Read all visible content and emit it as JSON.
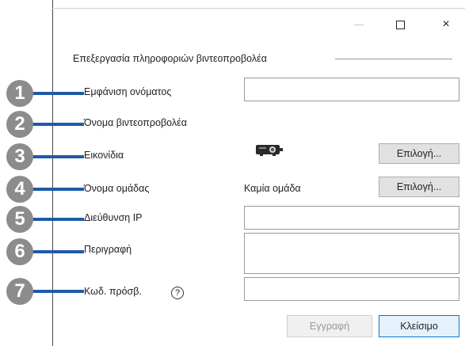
{
  "window": {
    "minimize_icon": "minimize-icon",
    "maximize_icon": "maximize-icon",
    "close_glyph": "×"
  },
  "group": {
    "title": "Επεξεργασία πληροφοριών βιντεοπροβολέα"
  },
  "callouts": [
    "1",
    "2",
    "3",
    "4",
    "5",
    "6",
    "7"
  ],
  "fields": {
    "display_name": {
      "label": "Εμφάνιση ονόματος",
      "value": ""
    },
    "projector_name": {
      "label": "Όνομα βιντεοπροβολέα",
      "value": ""
    },
    "icon": {
      "label": "Εικονίδια",
      "icon": "projector-icon",
      "button": "Επιλογή..."
    },
    "group_name": {
      "label": "Όνομα ομάδας",
      "value": "Καμία ομάδα",
      "button": "Επιλογή..."
    },
    "ip_address": {
      "label": "Διεύθυνση IP",
      "value": ""
    },
    "description": {
      "label": "Περιγραφή",
      "value": ""
    },
    "password": {
      "label": "Κωδ. πρόσβ.",
      "help": "?",
      "value": ""
    }
  },
  "footer": {
    "register": "Εγγραφή",
    "close": "Κλείσιμο"
  }
}
